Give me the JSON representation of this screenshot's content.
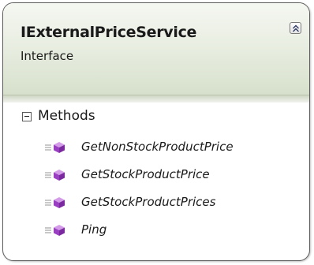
{
  "shape": {
    "title": "IExternalPriceService",
    "stereotype": "Interface"
  },
  "compartment": {
    "label": "Methods",
    "methods": [
      {
        "name": "GetNonStockProductPrice"
      },
      {
        "name": "GetStockProductPrice"
      },
      {
        "name": "GetStockProductPrices"
      },
      {
        "name": "Ping"
      }
    ]
  },
  "colors": {
    "method_icon": "#9b3fc2",
    "header_gradient_bottom": "#d7e0cc",
    "border": "#5d5d5d"
  },
  "icons": {
    "collapse": "double-chevron-up-icon",
    "toggle": "minus-square-icon",
    "method": "method-cube-icon"
  }
}
